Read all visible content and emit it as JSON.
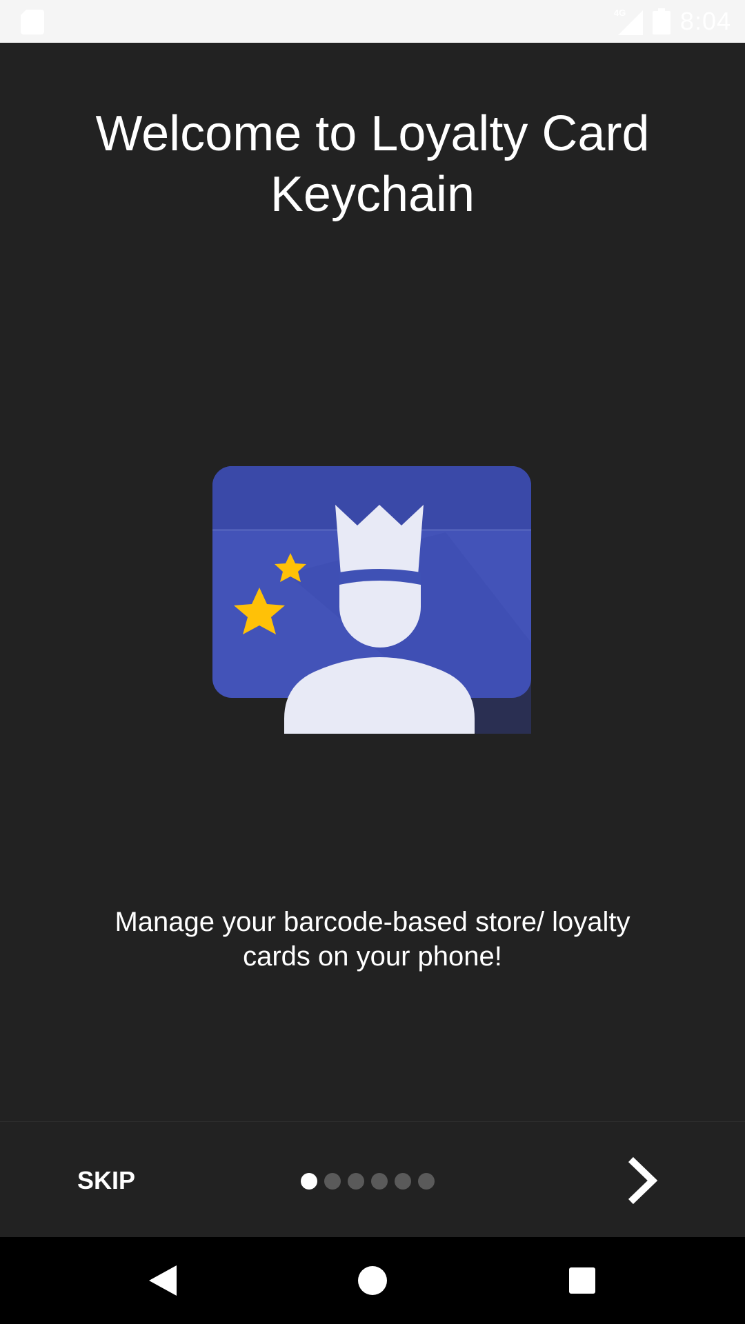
{
  "status_bar": {
    "time": "8:04",
    "network_label": "4G",
    "icons": [
      "sd-card-icon",
      "cell-signal-icon",
      "battery-icon"
    ]
  },
  "onboarding": {
    "title": "Welcome to Loyalty Card Keychain",
    "description": "Manage your barcode-based store/ loyalty cards on your phone!",
    "skip_label": "SKIP",
    "page_count": 6,
    "current_page": 1,
    "colors": {
      "background": "#222222",
      "card_blue": "#3f51b5",
      "star_yellow": "#ffc107",
      "figure_white": "#e8eaf6"
    }
  },
  "nav_bar": {
    "icons": [
      "back-icon",
      "home-icon",
      "recents-icon"
    ]
  }
}
